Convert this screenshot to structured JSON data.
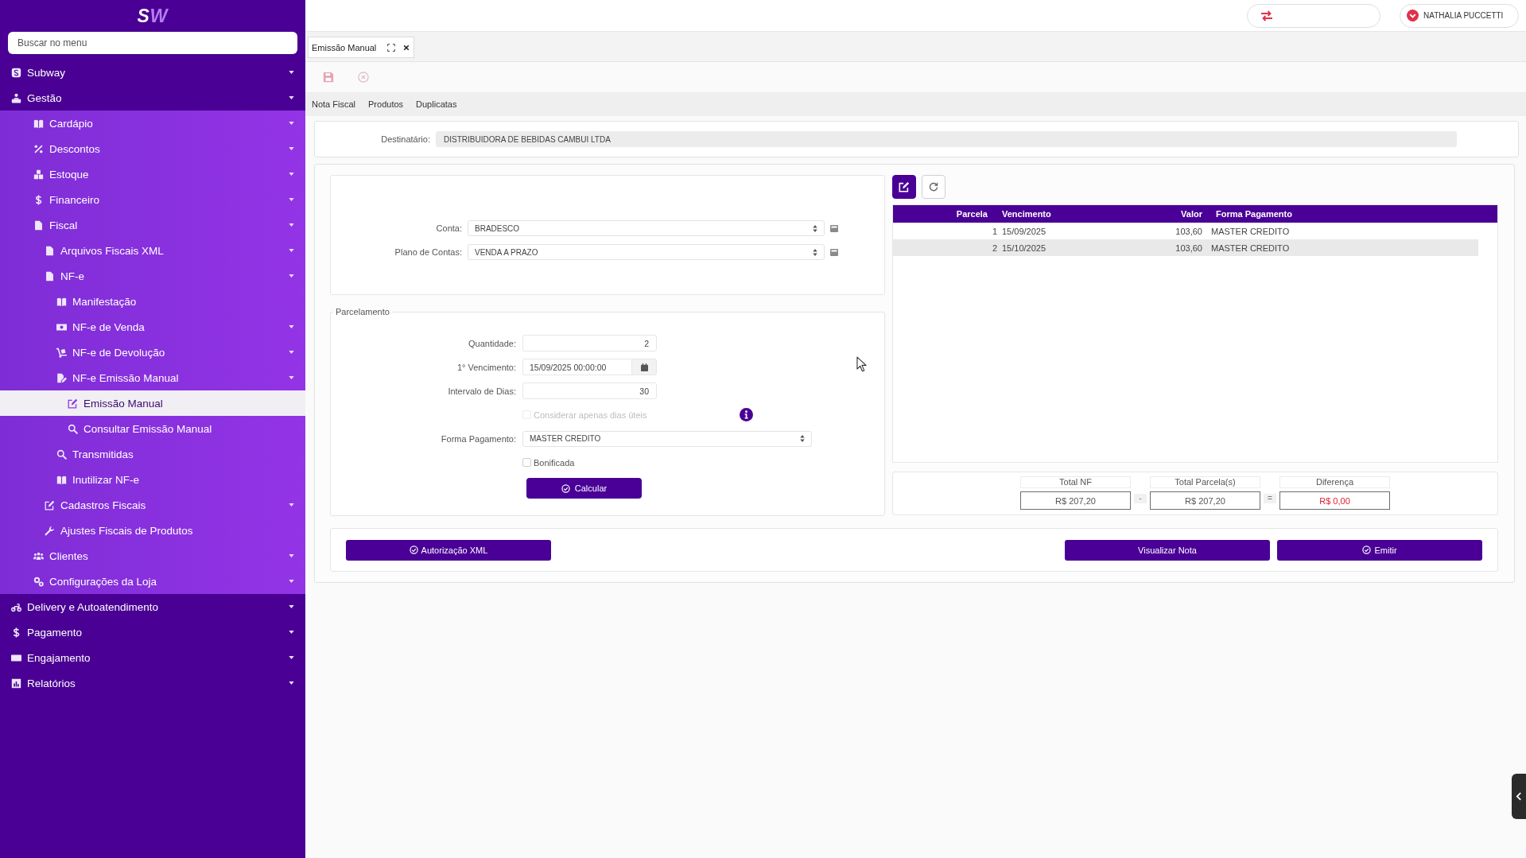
{
  "sidebar": {
    "logo": "SW",
    "search": {
      "placeholder": "Buscar no menu"
    },
    "items": [
      {
        "label": "Subway",
        "expandable": true,
        "selected": false
      },
      {
        "label": "Gestão",
        "expandable": true,
        "selected": false,
        "children": [
          {
            "label": "Cardápio",
            "expandable": true,
            "selected": false
          },
          {
            "label": "Descontos",
            "expandable": true,
            "selected": false
          },
          {
            "label": "Estoque",
            "expandable": true,
            "selected": false
          },
          {
            "label": "Financeiro",
            "expandable": true,
            "selected": false
          },
          {
            "label": "Fiscal",
            "expandable": true,
            "selected": false,
            "children": [
              {
                "label": "Arquivos Fiscais XML",
                "expandable": true,
                "selected": false
              },
              {
                "label": "NF-e",
                "expandable": true,
                "selected": false,
                "children": [
                  {
                    "label": "Manifestação",
                    "expandable": false,
                    "selected": false
                  },
                  {
                    "label": "NF-e de Venda",
                    "expandable": true,
                    "selected": false
                  },
                  {
                    "label": "NF-e de Devolução",
                    "expandable": true,
                    "selected": false
                  },
                  {
                    "label": "NF-e Emissão Manual",
                    "expandable": true,
                    "selected": false,
                    "children": [
                      {
                        "label": "Emissão Manual",
                        "expandable": false,
                        "selected": true
                      },
                      {
                        "label": "Consultar Emissão Manual",
                        "expandable": false,
                        "selected": false
                      }
                    ]
                  },
                  {
                    "label": "Transmitidas",
                    "expandable": false,
                    "selected": false
                  },
                  {
                    "label": "Inutilizar NF-e",
                    "expandable": false,
                    "selected": false
                  }
                ]
              },
              {
                "label": "Cadastros Fiscais",
                "expandable": true,
                "selected": false
              },
              {
                "label": "Ajustes Fiscais de Produtos",
                "expandable": false,
                "selected": false
              }
            ]
          },
          {
            "label": "Clientes",
            "expandable": true,
            "selected": false
          },
          {
            "label": "Configurações da Loja",
            "expandable": true,
            "selected": false
          }
        ]
      },
      {
        "label": "Delivery e Autoatendimento",
        "expandable": true,
        "selected": false
      },
      {
        "label": "Pagamento",
        "expandable": true,
        "selected": false
      },
      {
        "label": "Engajamento",
        "expandable": true,
        "selected": false
      },
      {
        "label": "Relatórios",
        "expandable": true,
        "selected": false
      }
    ]
  },
  "header": {
    "user": "NATHALIA PUCCETTI"
  },
  "tabs": [
    {
      "label": "Emissão Manual",
      "selected": true
    }
  ],
  "subtabs": [
    "Nota Fiscal",
    "Produtos",
    "Duplicatas"
  ],
  "recipient": {
    "label": "Destinatário:",
    "value": "DISTRIBUIDORA DE BEBIDAS CAMBUI LTDA"
  },
  "account_fields": [
    {
      "label": "Conta:",
      "value": "BRADESCO"
    },
    {
      "label": "Plano de Contas:",
      "value": "VENDA A PRAZO"
    }
  ],
  "installments": {
    "legend": "Parcelamento",
    "fields": [
      {
        "kind": "number",
        "label": "Quantidade:",
        "value": "2"
      },
      {
        "kind": "date",
        "label": "1° Vencimento:",
        "value": "15/09/2025 00:00:00"
      },
      {
        "kind": "number",
        "label": "Intervalo de Dias:",
        "value": "30"
      },
      {
        "kind": "checkbox",
        "label": "Considerar apenas dias úteis",
        "checked": false,
        "disabled": true,
        "info": true
      },
      {
        "kind": "select",
        "label": "Forma Pagamento:",
        "value": "MASTER CREDITO"
      },
      {
        "kind": "checkbox",
        "label": "Bonificada",
        "checked": false,
        "disabled": false
      }
    ],
    "button": "Calcular"
  },
  "schedule": {
    "columns": [
      "Parcela",
      "Vencimento",
      "Valor",
      "Forma Pagamento"
    ],
    "rows": [
      {
        "cells": [
          "1",
          "15/09/2025",
          "103,60",
          "MASTER CREDITO"
        ],
        "selected": false
      },
      {
        "cells": [
          "2",
          "15/10/2025",
          "103,60",
          "MASTER CREDITO"
        ],
        "selected": true
      }
    ]
  },
  "totals": {
    "items": [
      {
        "label": "Total NF",
        "value": "R$ 207,20",
        "color": "#555555"
      },
      {
        "label": "Total Parcela(s)",
        "value": "R$ 207,20",
        "color": "#555555"
      },
      {
        "label": "Diferença",
        "value": "R$ 0,00",
        "color": "#e0202e"
      }
    ],
    "operators": [
      "-",
      "="
    ]
  },
  "actions": {
    "left": [
      {
        "label": "Autorização XML",
        "kind": "check"
      }
    ],
    "right": [
      {
        "label": "Visualizar Nota",
        "kind": "plain"
      },
      {
        "label": "Emitir",
        "kind": "check"
      }
    ]
  }
}
